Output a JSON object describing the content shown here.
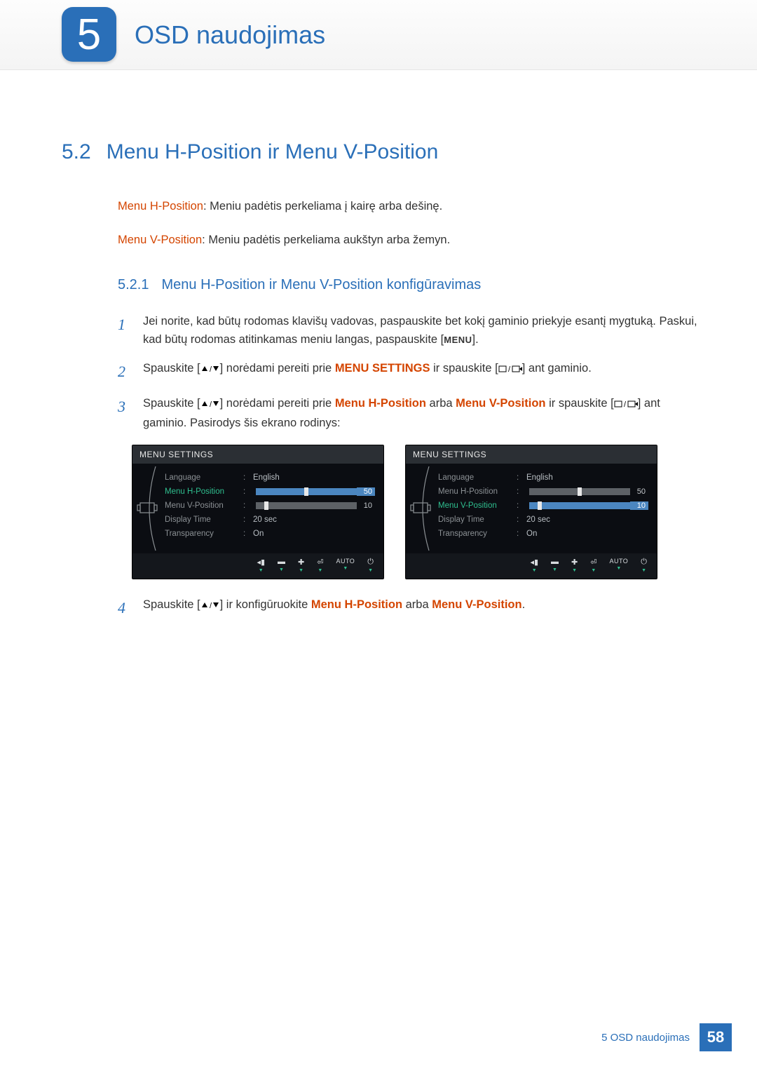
{
  "chapter": {
    "number": "5",
    "title": "OSD naudojimas"
  },
  "section": {
    "number": "5.2",
    "title": "Menu H-Position ir Menu V-Position"
  },
  "definitions": {
    "h": {
      "label": "Menu H-Position",
      "text": ": Meniu padėtis perkeliama į kairę arba dešinę."
    },
    "v": {
      "label": "Menu V-Position",
      "text": ": Meniu padėtis perkeliama aukštyn arba žemyn."
    }
  },
  "subsection": {
    "number": "5.2.1",
    "title": "Menu H-Position ir Menu V-Position konfigūravimas"
  },
  "steps": {
    "s1": {
      "num": "1",
      "a": "Jei norite, kad būtų rodomas klavišų vadovas, paspauskite bet kokį gaminio priekyje esantį mygtuką. Paskui, kad būtų rodomas atitinkamas meniu langas, paspauskite [",
      "menu": "MENU",
      "b": "]."
    },
    "s2": {
      "num": "2",
      "a": "Spauskite [",
      "b": "] norėdami pereiti prie ",
      "emph": "MENU SETTINGS",
      "c": " ir spauskite [",
      "d": "] ant gaminio."
    },
    "s3": {
      "num": "3",
      "a": "Spauskite [",
      "b": "] norėdami pereiti prie ",
      "h": "Menu H-Position",
      "or": " arba ",
      "v": "Menu V-Position",
      "c": " ir spauskite [",
      "d": "] ant gaminio. Pasirodys šis ekrano rodinys:"
    },
    "s4": {
      "num": "4",
      "a": "Spauskite [",
      "b": "] ir konfigūruokite ",
      "h": "Menu H-Position",
      "or": " arba ",
      "v": "Menu V-Position",
      "dot": "."
    }
  },
  "osd": {
    "title": "MENU SETTINGS",
    "items": {
      "lang": {
        "label": "Language",
        "value": "English"
      },
      "hpos": {
        "label": "Menu H-Position",
        "value": "50"
      },
      "vpos": {
        "label": "Menu V-Position",
        "value": "10"
      },
      "dtime": {
        "label": "Display Time",
        "value": "20 sec"
      },
      "trans": {
        "label": "Transparency",
        "value": "On"
      }
    },
    "footer": {
      "auto": "AUTO"
    }
  },
  "pageFooter": {
    "text": "5 OSD naudojimas",
    "page": "58"
  }
}
